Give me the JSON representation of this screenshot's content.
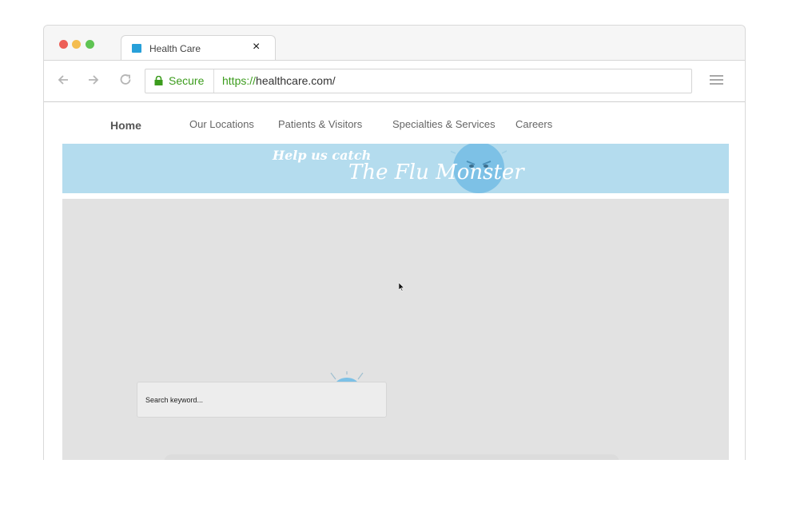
{
  "browser": {
    "tab": {
      "title": "Health Care",
      "close_glyph": "×",
      "favicon_color": "#27a0d9"
    },
    "nav": {
      "back_icon": "arrow-left-icon",
      "forward_icon": "arrow-right-icon",
      "reload_icon": "reload-icon"
    },
    "address": {
      "secure_label": "Secure",
      "url_scheme": "https://",
      "url_rest": "healthcare.com/"
    },
    "menu_icon": "hamburger-menu-icon"
  },
  "site": {
    "nav": {
      "home": "Home",
      "locations": "Our Locations",
      "patients": "Patients & Visitors",
      "specialties": "Specialties & Services",
      "careers": "Careers"
    },
    "banner": {
      "line1": "Help us catch",
      "line2": "The Flu Monster",
      "background": "#b4dcee"
    },
    "search": {
      "placeholder": "Search keyword..."
    }
  },
  "colors": {
    "secure_green": "#3c9c1d",
    "monster_blue": "#7dc1e6",
    "content_gray": "#e2e2e2"
  }
}
